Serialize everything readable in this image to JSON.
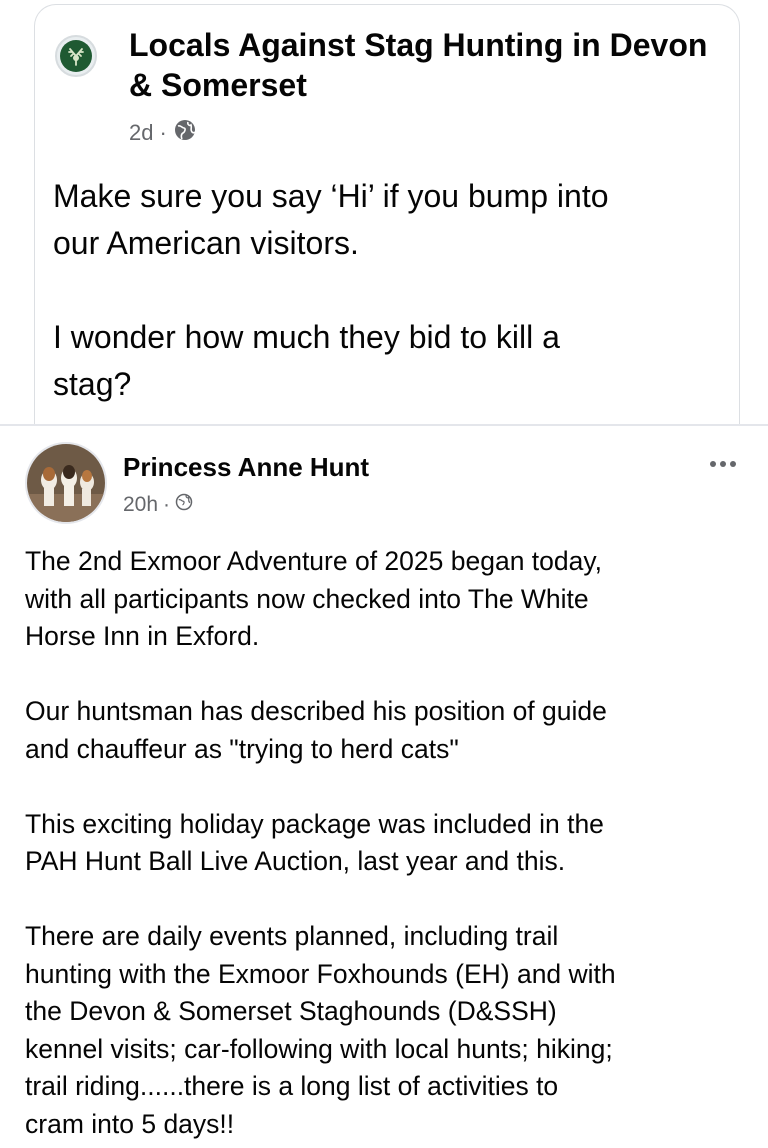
{
  "post_top": {
    "author": "Locals Against Stag Hunting in Devon & Somerset",
    "time": "2d",
    "separator": "·",
    "privacy_icon": "globe-icon",
    "body": "Make sure you say ‘Hi’ if you bump into\nour American visitors.\n\nI wonder how much they bid to kill a\nstag?"
  },
  "post_bottom": {
    "author": "Princess Anne Hunt",
    "time": "20h",
    "separator": "·",
    "privacy_icon": "globe-icon",
    "more_icon": "more-dots-icon",
    "body": "The 2nd Exmoor Adventure of 2025 began today,\nwith all participants now checked into The White\nHorse Inn in Exford.\n\nOur huntsman has described his position of guide\nand chauffeur as \"trying to herd cats\"\n\nThis exciting holiday package was included in the\nPAH Hunt Ball Live Auction, last year and this.\n\nThere are daily events planned, including trail\nhunting with the Exmoor Foxhounds (EH) and with\nthe Devon & Somerset Staghounds (D&SSH)\nkennel visits; car-following with local hunts; hiking;\ntrail riding......there is a long list of activities to\ncram into 5 days!!"
  },
  "colors": {
    "text_primary": "#050505",
    "text_secondary": "#65676b",
    "logo_green": "#1f5a32"
  }
}
